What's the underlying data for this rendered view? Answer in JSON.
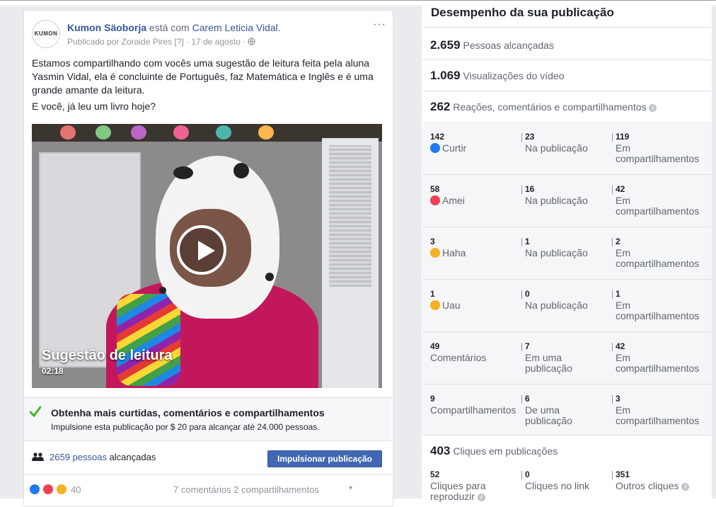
{
  "post": {
    "page_name": "Kumon Säoborja",
    "with_text": " está com ",
    "tagged": "Carem Leticia Vidal.",
    "published_by": "Publicado por Zoraide Pires [?] · 17 de agosto · ",
    "logo_text": "KUMON",
    "logo_subtext": "",
    "text_p1": "Estamos compartilhando com vocês uma sugestão de leitura feita pela aluna Yasmin Vidal, ela é concluinte de Português, faz Matemática e Inglês e é uma grande amante da leitura.",
    "text_p2": "E você, já leu um livro hoje?",
    "more_label": "···",
    "video": {
      "title": "Sugestão de leitura",
      "duration": "02:18"
    },
    "boost": {
      "title": "Obtenha mais curtidas, comentários e compartilhamentos",
      "desc": "Impulsione esta publicação por $ 20 para alcançar até 24.000 pessoas."
    },
    "reach_count": "2659 pessoas",
    "reach_suffix": " alcançadas",
    "boost_button": "Impulsionar publicação",
    "reactions_count": "40",
    "footer_stats": "7 comentários  2 compartilhamentos",
    "footer_menu": "▾"
  },
  "panel": {
    "title": "Desempenho da sua publicação",
    "reached_num": "2.659",
    "reached_label": "Pessoas alcançadas",
    "views_num": "1.069",
    "views_label": "Visualizações do vídeo",
    "engagement_num": "262",
    "engagement_label": "Reações, comentários e compartilhamentos",
    "rows": [
      {
        "total": "142",
        "label": "Curtir",
        "on_post": "23",
        "on_post_label": "Na publicação",
        "shares": "119",
        "shares_label": "Em compartilhamentos"
      },
      {
        "total": "58",
        "label": "Amei",
        "on_post": "16",
        "on_post_label": "Na publicação",
        "shares": "42",
        "shares_label": "Em compartilhamentos"
      },
      {
        "total": "3",
        "label": "Haha",
        "on_post": "1",
        "on_post_label": "Na publicação",
        "shares": "2",
        "shares_label": "Em compartilhamentos"
      },
      {
        "total": "1",
        "label": "Uau",
        "on_post": "0",
        "on_post_label": "Na publicação",
        "shares": "1",
        "shares_label": "Em compartilhamentos"
      },
      {
        "total": "49",
        "label": "Comentários",
        "on_post": "7",
        "on_post_label": "Em uma publicação",
        "shares": "42",
        "shares_label": "Em compartilhamentos"
      },
      {
        "total": "9",
        "label": "Compartilhamentos",
        "on_post": "6",
        "on_post_label": "De uma publicação",
        "shares": "3",
        "shares_label": "Em compartilhamentos"
      }
    ],
    "clicks_num": "403",
    "clicks_label": "Cliques em publicações",
    "clicks": [
      {
        "n": "52",
        "label": "Cliques para reproduzir"
      },
      {
        "n": "0",
        "label": "Cliques no link"
      },
      {
        "n": "351",
        "label": "Outros cliques"
      }
    ],
    "info_glyph": "i"
  }
}
